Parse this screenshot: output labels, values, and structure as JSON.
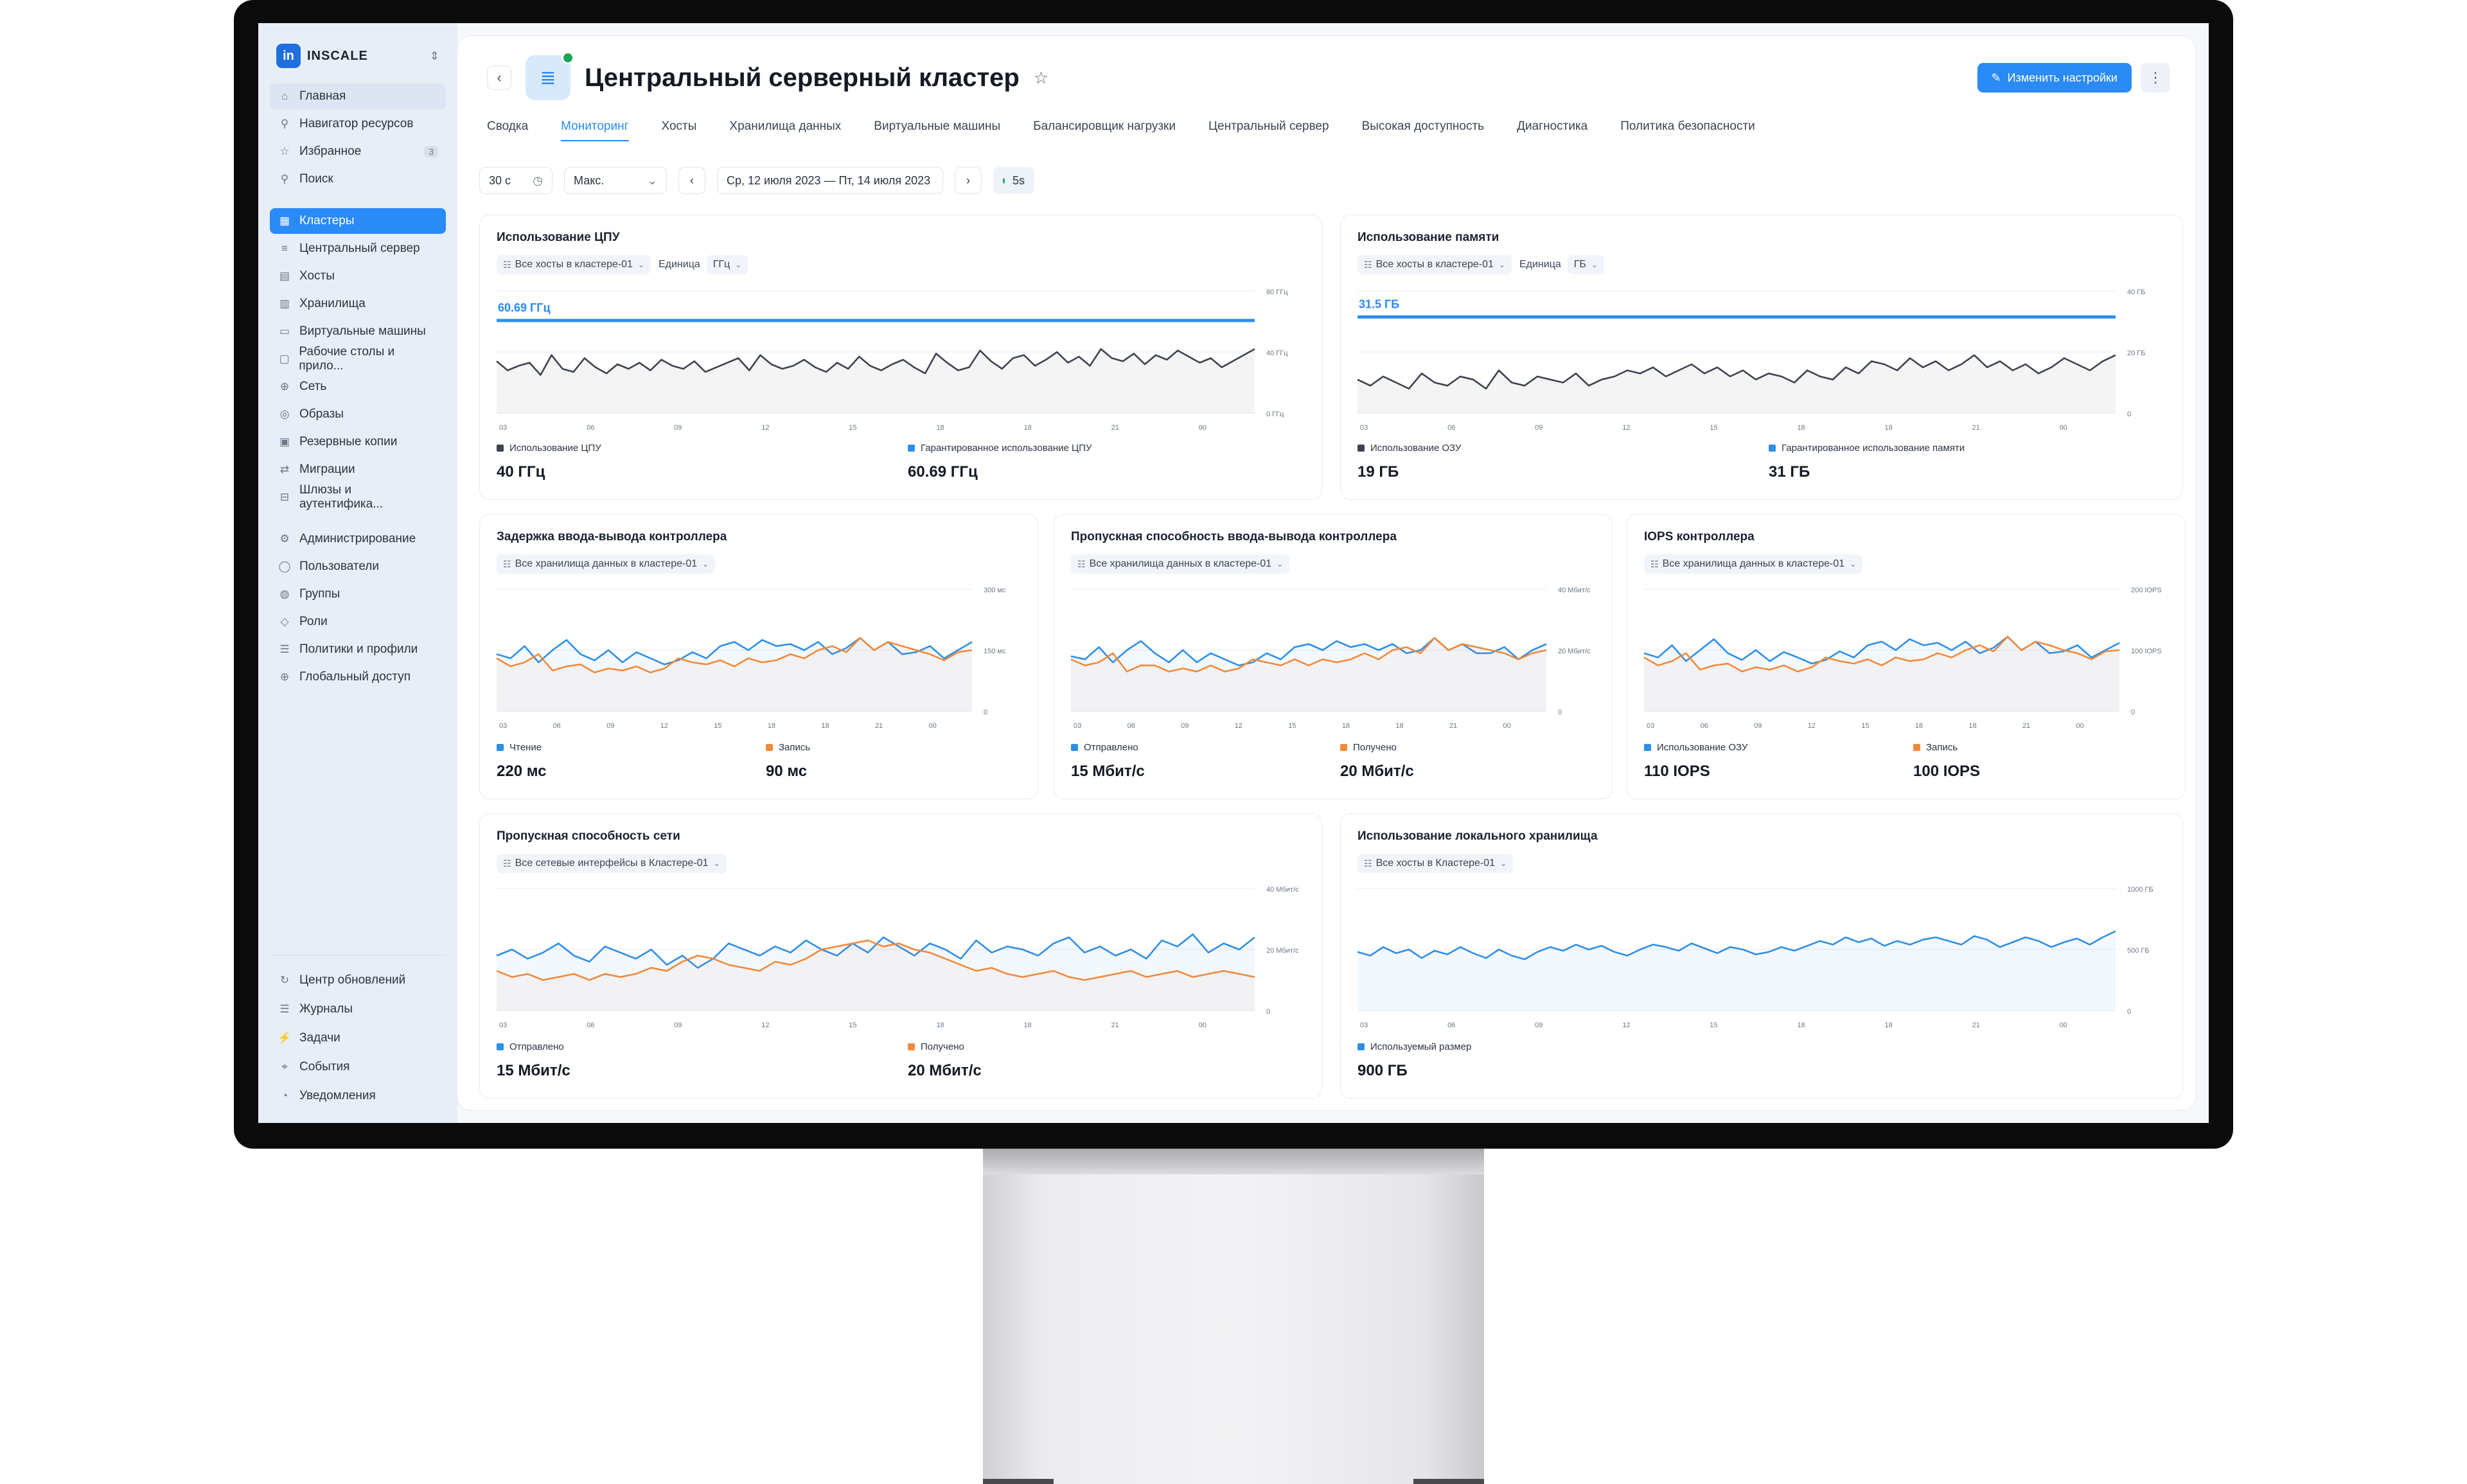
{
  "sidebar": {
    "brand": "INSCALE",
    "items": [
      {
        "label": "Главная",
        "icon": "home-icon",
        "name": "home"
      },
      {
        "label": "Навигатор ресурсов",
        "icon": "navigator-icon",
        "name": "resource-navigator"
      },
      {
        "label": "Избранное",
        "icon": "star-icon",
        "name": "favorites",
        "badge": "3"
      },
      {
        "label": "Поиск",
        "icon": "search-icon",
        "name": "search"
      }
    ],
    "items2": [
      {
        "label": "Кластеры",
        "icon": "cluster-icon",
        "name": "clusters"
      },
      {
        "label": "Центральный сервер",
        "icon": "server-icon",
        "name": "central-server"
      },
      {
        "label": "Хосты",
        "icon": "host-icon",
        "name": "hosts"
      },
      {
        "label": "Хранилища",
        "icon": "storage-icon",
        "name": "storages"
      },
      {
        "label": "Виртуальные машины",
        "icon": "vm-icon",
        "name": "vms"
      },
      {
        "label": "Рабочие столы и прило...",
        "icon": "desktop-icon",
        "name": "desktops"
      },
      {
        "label": "Сеть",
        "icon": "network-icon",
        "name": "network"
      },
      {
        "label": "Образы",
        "icon": "disk-icon",
        "name": "images"
      },
      {
        "label": "Резервные копии",
        "icon": "backup-icon",
        "name": "backups"
      },
      {
        "label": "Миграции",
        "icon": "migration-icon",
        "name": "migrations"
      },
      {
        "label": "Шлюзы и аутентифика...",
        "icon": "gateway-icon",
        "name": "gateways"
      }
    ],
    "items3": [
      {
        "label": "Администрирование",
        "icon": "admin-icon",
        "name": "administration"
      },
      {
        "label": "Пользователи",
        "icon": "user-icon",
        "name": "users"
      },
      {
        "label": "Группы",
        "icon": "group-icon",
        "name": "groups"
      },
      {
        "label": "Роли",
        "icon": "role-icon",
        "name": "roles"
      },
      {
        "label": "Политики и профили",
        "icon": "policy-icon",
        "name": "policies"
      },
      {
        "label": "Глобальный доступ",
        "icon": "globe-icon",
        "name": "global-access"
      }
    ],
    "bottom": [
      {
        "label": "Центр обновлений",
        "icon": "refresh-icon",
        "name": "update-center"
      },
      {
        "label": "Журналы",
        "icon": "log-icon",
        "name": "logs"
      },
      {
        "label": "Задачи",
        "icon": "task-icon",
        "name": "tasks"
      },
      {
        "label": "События",
        "icon": "event-icon",
        "name": "events"
      },
      {
        "label": "Уведомления",
        "icon": "bell-icon",
        "name": "notifications"
      }
    ]
  },
  "header": {
    "title": "Центральный серверный кластер",
    "edit_label": "Изменить настройки",
    "status_color": "#17a55a"
  },
  "tabs": [
    "Сводка",
    "Мониторинг",
    "Хосты",
    "Хранилища данных",
    "Виртуальные машины",
    "Балансировщик нагрузки",
    "Центральный сервер",
    "Высокая доступность",
    "Диагностика",
    "Политика безопасности"
  ],
  "active_tab": "Мониторинг",
  "toolbar": {
    "interval": "30 с",
    "range": "Макс.",
    "dates": "Ср, 12 июля 2023 — Пт, 14 июля 2023",
    "refresh": "5s"
  },
  "colors": {
    "accent": "#2a8af6",
    "series_dark": "#3d4350",
    "series_blue": "#2f8fe6",
    "series_orange": "#f08a3c"
  },
  "x_ticks": [
    "03",
    "06",
    "09",
    "12",
    "15",
    "18",
    "18",
    "21",
    "00"
  ],
  "charts": {
    "cpu": {
      "title": "Использование ЦПУ",
      "filter": "Все хосты в кластере-01",
      "unit_label": "Единица",
      "unit": "ГГц",
      "ref_label": "60.69 ГГц",
      "ticks": [
        "80 ГГц",
        "40 ГГц",
        "0 ГГц"
      ],
      "legend": [
        {
          "label": "Использование ЦПУ",
          "value": "40 ГГц"
        },
        {
          "label": "Гарантированное использование ЦПУ",
          "value": "60.69 ГГц"
        }
      ]
    },
    "mem": {
      "title": "Использование памяти",
      "filter": "Все хосты в кластере-01",
      "unit_label": "Единица",
      "unit": "ГБ",
      "ref_label": "31.5 ГБ",
      "ticks": [
        "40 ГБ",
        "20 ГБ",
        "0"
      ],
      "legend": [
        {
          "label": "Использование ОЗУ",
          "value": "19 ГБ"
        },
        {
          "label": "Гарантированное использование памяти",
          "value": "31 ГБ"
        }
      ]
    },
    "latency": {
      "title": "Задержка ввода-вывода контроллера",
      "filter": "Все хранилища данных в кластере-01",
      "ticks": [
        "300 мс",
        "150 мс",
        "0"
      ],
      "legend": [
        {
          "label": "Чтение",
          "value": "220 мс"
        },
        {
          "label": "Запись",
          "value": "90 мс"
        }
      ]
    },
    "throughput": {
      "title": "Пропускная способность ввода-вывода контроллера",
      "filter": "Все хранилища данных в кластере-01",
      "ticks": [
        "40 Мбит/с",
        "20 Мбит/с",
        "0"
      ],
      "legend": [
        {
          "label": "Отправлено",
          "value": "15 Мбит/с"
        },
        {
          "label": "Получено",
          "value": "20 Мбит/с"
        }
      ]
    },
    "iops": {
      "title": "IOPS контроллера",
      "filter": "Все хранилища данных в кластере-01",
      "ticks": [
        "200 IOPS",
        "100 IOPS",
        "0"
      ],
      "legend": [
        {
          "label": "Использование ОЗУ",
          "value": "110 IOPS"
        },
        {
          "label": "Запись",
          "value": "100 IOPS"
        }
      ]
    },
    "net": {
      "title": "Пропускная способность сети",
      "filter": "Все сетевые интерфейсы в Кластере-01",
      "ticks": [
        "40 Мбит/с",
        "20 Мбит/с",
        "0"
      ],
      "legend": [
        {
          "label": "Отправлено",
          "value": "15 Мбит/с"
        },
        {
          "label": "Получено",
          "value": "20 Мбит/с"
        }
      ]
    },
    "disk": {
      "title": "Использование локального хранилища",
      "filter": "Все хосты в Кластере-01",
      "ticks": [
        "1000 ГБ",
        "500 ГБ",
        "0"
      ],
      "legend": [
        {
          "label": "Используемый размер",
          "value": "900 ГБ"
        }
      ]
    }
  },
  "chart_data": [
    {
      "type": "line",
      "title": "Использование ЦПУ",
      "ylim": [
        0,
        80
      ],
      "categories": [
        "03",
        "06",
        "09",
        "12",
        "15",
        "18",
        "18",
        "21",
        "00"
      ],
      "series": [
        {
          "name": "Использование ЦПУ",
          "values": [
            34,
            28,
            31,
            33,
            25,
            38,
            29,
            27,
            36,
            30,
            26,
            32,
            29,
            33,
            28,
            35,
            31,
            29,
            34,
            27,
            30,
            33,
            36,
            28,
            38,
            32,
            29,
            31,
            35,
            30,
            27,
            33,
            29,
            37,
            31,
            28,
            32,
            35,
            30,
            26,
            39,
            33,
            28,
            30,
            41,
            34,
            29,
            36,
            38,
            31,
            35,
            40,
            33,
            37,
            31,
            42,
            36,
            34,
            39,
            32,
            38,
            35,
            41,
            37,
            33,
            36,
            30,
            34,
            38,
            42
          ]
        },
        {
          "name": "Гарантированное использование ЦПУ",
          "values": [
            60.69
          ]
        }
      ]
    },
    {
      "type": "line",
      "title": "Использование памяти",
      "ylim": [
        0,
        40
      ],
      "categories": [
        "03",
        "06",
        "09",
        "12",
        "15",
        "18",
        "18",
        "21",
        "00"
      ],
      "series": [
        {
          "name": "Использование ОЗУ",
          "values": [
            11,
            9,
            12,
            10,
            8,
            13,
            10,
            9,
            12,
            11,
            8,
            14,
            10,
            9,
            12,
            11,
            10,
            13,
            9,
            11,
            12,
            14,
            13,
            15,
            12,
            14,
            16,
            13,
            15,
            12,
            14,
            11,
            13,
            12,
            10,
            14,
            12,
            11,
            15,
            13,
            17,
            16,
            14,
            18,
            15,
            17,
            14,
            16,
            19,
            15,
            17,
            14,
            16,
            13,
            15,
            18,
            16,
            14,
            17,
            19
          ]
        },
        {
          "name": "Гарантированное использование памяти",
          "values": [
            31.5
          ]
        }
      ]
    },
    {
      "type": "line",
      "title": "Задержка ввода-вывода контроллера",
      "ylim": [
        0,
        300
      ],
      "categories": [
        "03",
        "06",
        "09",
        "12",
        "15",
        "18",
        "18",
        "21",
        "00"
      ],
      "series": [
        {
          "name": "Чтение",
          "values": [
            140,
            130,
            160,
            120,
            150,
            175,
            140,
            125,
            150,
            120,
            145,
            130,
            115,
            125,
            145,
            130,
            160,
            170,
            150,
            175,
            160,
            165,
            150,
            170,
            140,
            155,
            180,
            150,
            170,
            140,
            145,
            160,
            130,
            150,
            170
          ]
        },
        {
          "name": "Запись",
          "values": [
            130,
            110,
            120,
            140,
            100,
            110,
            115,
            95,
            105,
            100,
            110,
            95,
            105,
            130,
            120,
            115,
            125,
            110,
            130,
            120,
            125,
            140,
            130,
            150,
            160,
            145,
            180,
            150,
            170,
            160,
            150,
            140,
            125,
            145,
            150
          ]
        }
      ]
    },
    {
      "type": "line",
      "title": "Пропускная способность ввода-вывода контроллера",
      "ylim": [
        0,
        40
      ],
      "categories": [
        "03",
        "06",
        "09",
        "12",
        "15",
        "18",
        "18",
        "21",
        "00"
      ],
      "series": [
        {
          "name": "Отправлено",
          "values": [
            18,
            17,
            21,
            16,
            20,
            23,
            19,
            16,
            20,
            16,
            19,
            17,
            15,
            16,
            19,
            17,
            21,
            22,
            20,
            23,
            21,
            22,
            20,
            22,
            19,
            20,
            24,
            20,
            22,
            19,
            19,
            21,
            17,
            20,
            22
          ]
        },
        {
          "name": "Получено",
          "values": [
            17,
            15,
            16,
            19,
            13,
            15,
            15,
            13,
            14,
            13,
            15,
            13,
            14,
            17,
            16,
            15,
            17,
            15,
            17,
            16,
            17,
            19,
            17,
            20,
            21,
            19,
            24,
            20,
            22,
            21,
            20,
            19,
            17,
            19,
            20
          ]
        }
      ]
    },
    {
      "type": "line",
      "title": "IOPS контроллера",
      "ylim": [
        0,
        200
      ],
      "categories": [
        "03",
        "06",
        "09",
        "12",
        "15",
        "18",
        "18",
        "21",
        "00"
      ],
      "series": [
        {
          "name": "Использование ОЗУ",
          "values": [
            95,
            88,
            108,
            82,
            100,
            118,
            95,
            84,
            100,
            82,
            97,
            88,
            78,
            84,
            98,
            88,
            108,
            114,
            100,
            118,
            108,
            112,
            100,
            114,
            95,
            104,
            122,
            100,
            114,
            95,
            98,
            108,
            88,
            100,
            112
          ]
        },
        {
          "name": "Запись",
          "values": [
            88,
            75,
            82,
            95,
            68,
            75,
            78,
            65,
            72,
            68,
            75,
            65,
            72,
            88,
            82,
            78,
            85,
            75,
            88,
            82,
            85,
            95,
            88,
            100,
            108,
            98,
            122,
            100,
            114,
            108,
            100,
            95,
            85,
            98,
            100
          ]
        }
      ]
    },
    {
      "type": "line",
      "title": "Пропускная способность сети",
      "ylim": [
        0,
        40
      ],
      "categories": [
        "03",
        "06",
        "09",
        "12",
        "15",
        "18",
        "18",
        "21",
        "00"
      ],
      "series": [
        {
          "name": "Отправлено",
          "values": [
            18,
            20,
            17,
            19,
            22,
            18,
            16,
            21,
            19,
            17,
            20,
            15,
            18,
            14,
            17,
            22,
            20,
            18,
            21,
            19,
            23,
            20,
            18,
            22,
            19,
            24,
            21,
            18,
            22,
            20,
            17,
            23,
            19,
            21,
            20,
            18,
            22,
            24,
            19,
            21,
            18,
            20,
            17,
            23,
            21,
            25,
            19,
            22,
            20,
            24
          ]
        },
        {
          "name": "Получено",
          "values": [
            13,
            11,
            12,
            10,
            11,
            12,
            10,
            12,
            11,
            12,
            14,
            13,
            16,
            18,
            17,
            15,
            14,
            13,
            16,
            15,
            17,
            20,
            21,
            22,
            23,
            21,
            22,
            20,
            19,
            17,
            15,
            13,
            14,
            12,
            11,
            12,
            13,
            11,
            10,
            11,
            12,
            13,
            11,
            12,
            13,
            11,
            12,
            13,
            12,
            11
          ]
        }
      ]
    },
    {
      "type": "line",
      "title": "Использование локального хранилища",
      "ylim": [
        0,
        1000
      ],
      "categories": [
        "03",
        "06",
        "09",
        "12",
        "15",
        "18",
        "18",
        "21",
        "00"
      ],
      "series": [
        {
          "name": "Используемый размер",
          "values": [
            480,
            450,
            520,
            470,
            500,
            430,
            490,
            460,
            520,
            470,
            430,
            500,
            450,
            420,
            480,
            520,
            490,
            540,
            500,
            530,
            480,
            450,
            500,
            540,
            520,
            490,
            550,
            510,
            470,
            520,
            500,
            460,
            480,
            520,
            490,
            530,
            570,
            540,
            600,
            560,
            590,
            530,
            570,
            540,
            580,
            600,
            570,
            540,
            610,
            580,
            520,
            560,
            600,
            570,
            520,
            560,
            590,
            540,
            600,
            650
          ]
        }
      ]
    }
  ]
}
